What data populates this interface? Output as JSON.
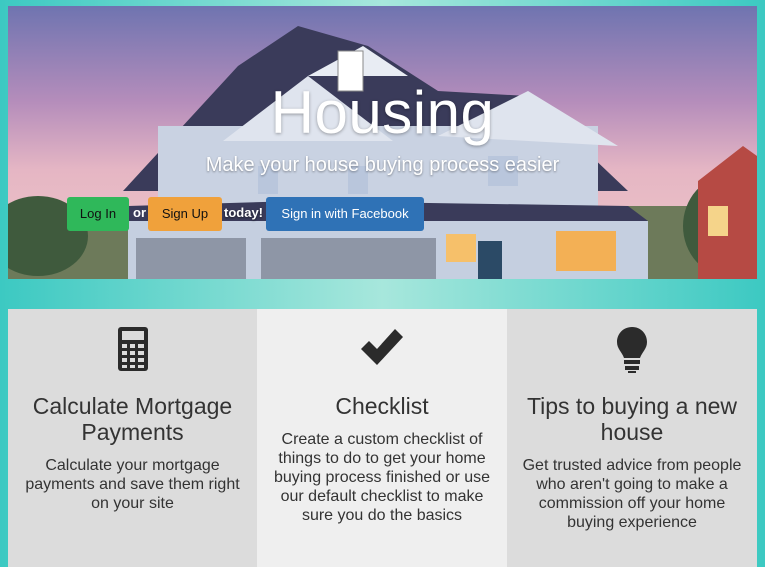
{
  "hero": {
    "title": "Housing",
    "subtitle": "Make your house buying process easier",
    "login_label": "Log In",
    "or_label": "or",
    "signup_label": "Sign Up",
    "today_label": "today!",
    "facebook_label": "Sign in with Facebook"
  },
  "features": [
    {
      "icon": "calculator-icon",
      "title": "Calculate Mortgage Payments",
      "text": "Calculate your mortgage payments and save them right on your site"
    },
    {
      "icon": "checkmark-icon",
      "title": "Checklist",
      "text": "Create a custom checklist of things to do to get your home buying process finished or use our default checklist to make sure you do the basics"
    },
    {
      "icon": "lightbulb-icon",
      "title": "Tips to buying a new house",
      "text": "Get trusted advice from people who aren't going to make a commission off your home buying experience"
    }
  ],
  "colors": {
    "login": "#2fb85a",
    "signup": "#f0a13b",
    "facebook": "#2f72b6",
    "background": "#3cc9c2"
  }
}
